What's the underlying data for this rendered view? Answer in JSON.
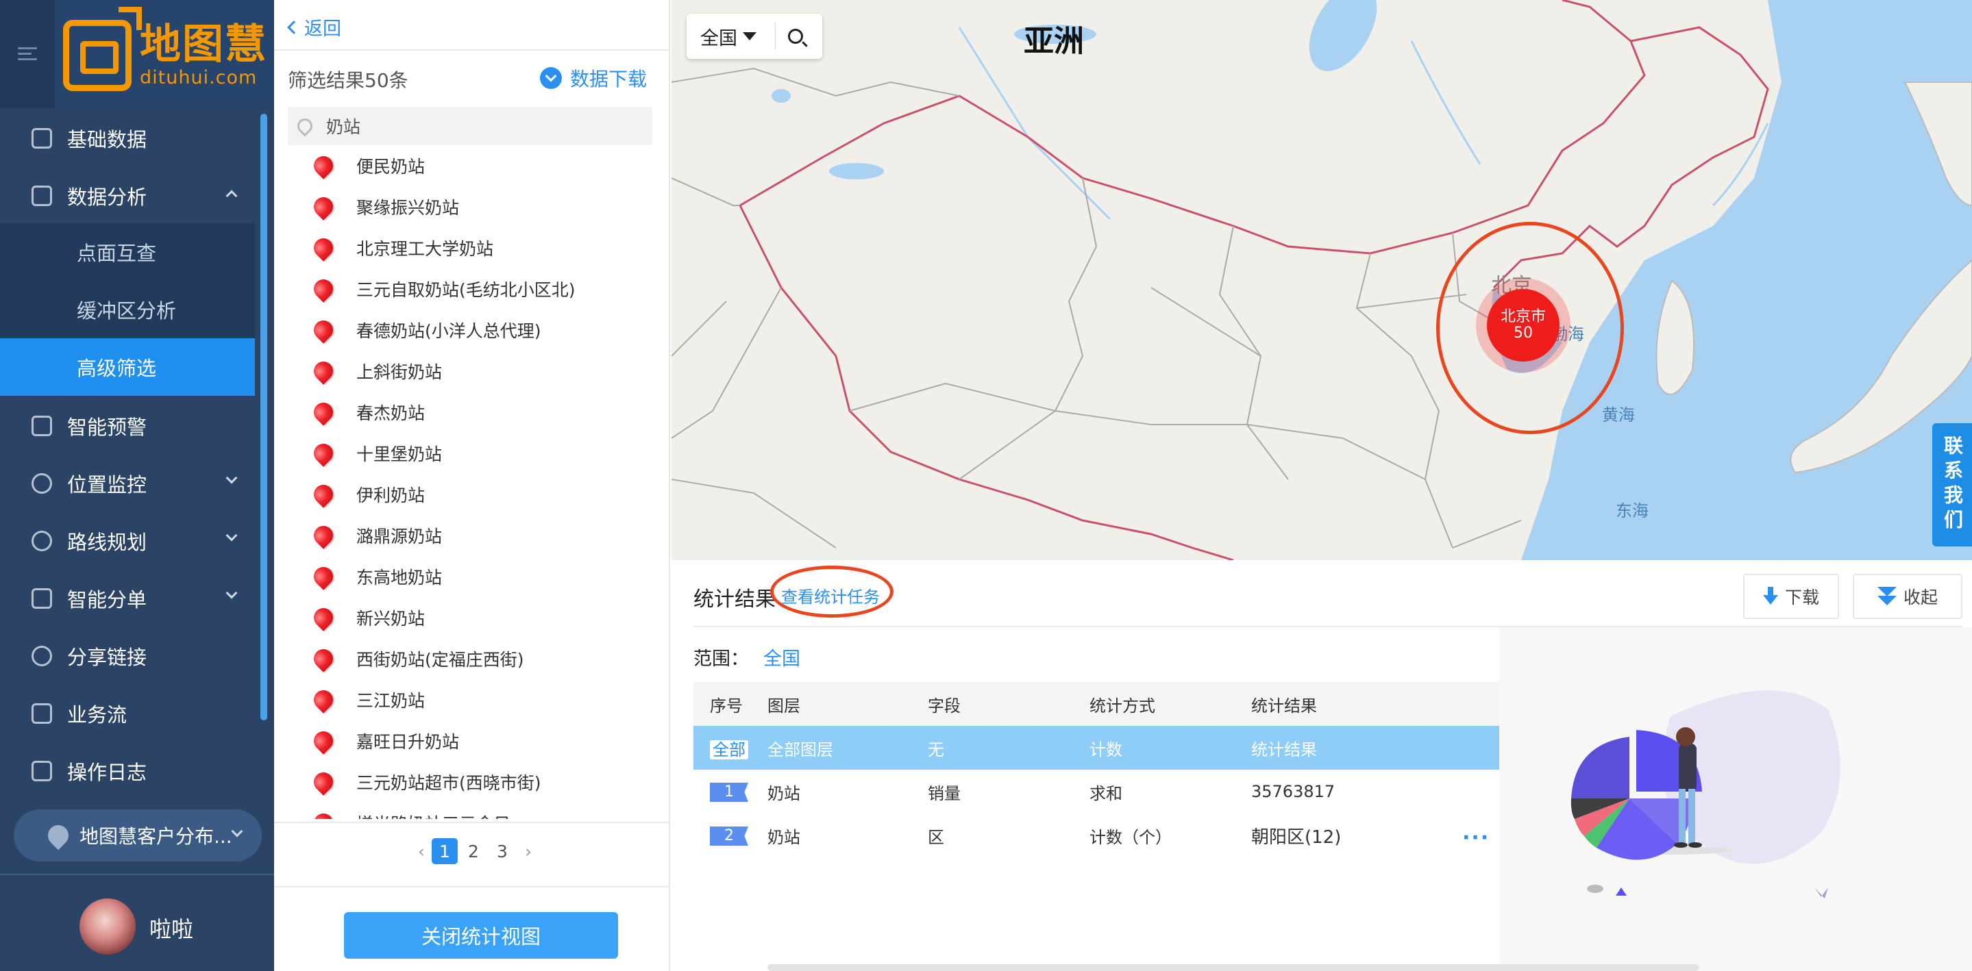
{
  "brand": {
    "name_cn": "地图慧",
    "name_en": "dituhui.com"
  },
  "sidebar": {
    "items": [
      {
        "label": "基础数据"
      },
      {
        "label": "数据分析"
      },
      {
        "label": "智能预警"
      },
      {
        "label": "位置监控"
      },
      {
        "label": "路线规划"
      },
      {
        "label": "智能分单"
      },
      {
        "label": "分享链接"
      },
      {
        "label": "业务流"
      },
      {
        "label": "操作日志"
      }
    ],
    "subitems": [
      {
        "label": "点面互查"
      },
      {
        "label": "缓冲区分析"
      },
      {
        "label": "高级筛选"
      }
    ],
    "layer_selector": "地图慧客户分布...",
    "user_name": "啦啦"
  },
  "list_panel": {
    "back_label": "返回",
    "result_count": "筛选结果50条",
    "download_label": "数据下载",
    "layer_name": "奶站",
    "items": [
      "便民奶站",
      "聚缘振兴奶站",
      "北京理工大学奶站",
      "三元自取奶站(毛纺北小区北)",
      "春德奶站(小洋人总代理)",
      "上斜街奶站",
      "春杰奶站",
      "十里堡奶站",
      "伊利奶站",
      "潞鼎源奶站",
      "东高地奶站",
      "新兴奶站",
      "西街奶站(定福庄西街)",
      "三江奶站",
      "嘉旺日升奶站",
      "三元奶站超市(西晓市街)",
      "增光路奶站三元金日"
    ],
    "pages": [
      "1",
      "2",
      "3"
    ],
    "prev": "‹",
    "next": "›",
    "close_view_label": "关闭统计视图"
  },
  "map": {
    "region_select": "全国",
    "continent_label": "亚洲",
    "beijing_label": "北京",
    "cluster_city": "北京市",
    "cluster_count": "50",
    "seas": [
      "渤海",
      "黄海",
      "东海"
    ],
    "contact": "联系我们"
  },
  "stats": {
    "title": "统计结果",
    "view_tasks": "查看统计任务",
    "download_label": "下载",
    "collapse_label": "收起",
    "range_label": "范围：",
    "range_value": "全国",
    "headers": [
      "序号",
      "图层",
      "字段",
      "统计方式",
      "统计结果"
    ],
    "rows": [
      [
        "全部",
        "全部图层",
        "无",
        "计数",
        "统计结果"
      ],
      [
        "1",
        "奶站",
        "销量",
        "求和",
        "35763817"
      ],
      [
        "2",
        "奶站",
        "区",
        "计数（个）",
        "朝阳区(12)"
      ]
    ],
    "more": "···"
  },
  "colors": {
    "accent": "#2b8ff0",
    "brand_orange": "#f39800",
    "highlight": "#e8461f",
    "cluster": "#ef1c1c"
  }
}
